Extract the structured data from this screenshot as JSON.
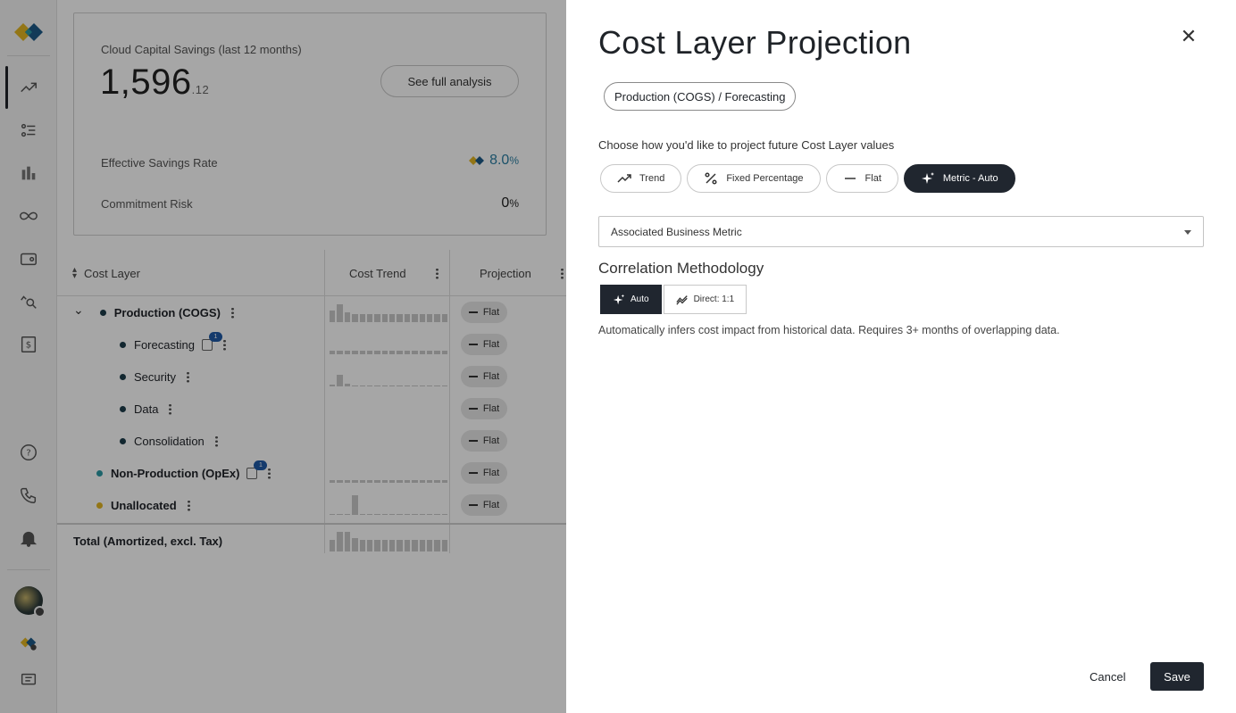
{
  "summary": {
    "title": "Cloud Capital Savings (last 12 months)",
    "amount_main": "1,596",
    "amount_decimal": ".12",
    "see_analysis": "See full analysis",
    "effective_rate_label": "Effective Savings Rate",
    "effective_rate_value": "8.0",
    "effective_rate_unit": "%",
    "risk_label": "Commitment Risk",
    "risk_value": "0",
    "risk_unit": "%"
  },
  "table": {
    "headers": {
      "cost_layer": "Cost Layer",
      "cost_trend": "Cost Trend",
      "projection": "Projection"
    },
    "rows": [
      {
        "label": "Production (COGS)",
        "bold": true,
        "projection": "Flat",
        "dot": "#1c3c4a",
        "spark": [
          0.6,
          0.9,
          0.5,
          0.4,
          0.4,
          0.4,
          0.4,
          0.4,
          0.4,
          0.4,
          0.4,
          0.4,
          0.4,
          0.4,
          0.4,
          0.4
        ]
      },
      {
        "label": "Forecasting",
        "bold": false,
        "badge": "1",
        "projection": "Flat",
        "dot": "#1c3c4a",
        "spark": [
          0.2,
          0.2,
          0.2,
          0.2,
          0.2,
          0.2,
          0.2,
          0.2,
          0.2,
          0.2,
          0.2,
          0.2,
          0.2,
          0.2,
          0.2,
          0.2
        ]
      },
      {
        "label": "Security",
        "bold": false,
        "projection": "Flat",
        "dot": "#1c3c4a",
        "spark": [
          0.1,
          0.6,
          0.15,
          0.05,
          0.05,
          0.05,
          0.05,
          0.05,
          0.05,
          0.05,
          0.05,
          0.05,
          0.05,
          0.05,
          0.05,
          0.05
        ]
      },
      {
        "label": "Data",
        "bold": false,
        "projection": "Flat",
        "dot": "#1c3c4a",
        "spark": []
      },
      {
        "label": "Consolidation",
        "bold": false,
        "projection": "Flat",
        "dot": "#1c3c4a",
        "spark": []
      },
      {
        "label": "Non-Production (OpEx)",
        "bold": true,
        "badge": "1",
        "projection": "Flat",
        "dot": "#2b9aa5",
        "spark": [
          0.15,
          0.15,
          0.15,
          0.15,
          0.15,
          0.15,
          0.15,
          0.15,
          0.15,
          0.15,
          0.15,
          0.15,
          0.15,
          0.15,
          0.15,
          0.15
        ]
      },
      {
        "label": "Unallocated",
        "bold": true,
        "projection": "Flat",
        "dot": "#e2b523",
        "spark": [
          0.05,
          0.05,
          0.05,
          1.0,
          0.05,
          0.05,
          0.05,
          0.05,
          0.05,
          0.05,
          0.05,
          0.05,
          0.05,
          0.05,
          0.05,
          0.05
        ]
      }
    ],
    "total_label": "Total (Amortized, excl. Tax)",
    "total_spark": [
      0.6,
      1.0,
      1.0,
      0.7,
      0.6,
      0.6,
      0.6,
      0.6,
      0.6,
      0.6,
      0.6,
      0.6,
      0.6,
      0.6,
      0.6,
      0.6
    ]
  },
  "drawer": {
    "title": "Cost Layer Projection",
    "breadcrumb": "Production (COGS) / Forecasting",
    "prompt": "Choose how you'd like to project future Cost Layer values",
    "methods": [
      {
        "label": "Trend",
        "icon": "trend-icon",
        "selected": false
      },
      {
        "label": "Fixed Percentage",
        "icon": "percent-icon",
        "selected": false
      },
      {
        "label": "Flat",
        "icon": "flat-line-icon",
        "selected": false
      },
      {
        "label": "Metric - Auto",
        "icon": "sparkle-icon",
        "selected": true
      }
    ],
    "metric_select_placeholder": "Associated Business Metric",
    "correlation_title": "Correlation Methodology",
    "correlation_options": [
      {
        "label": "Auto",
        "icon": "sparkle-icon",
        "selected": true
      },
      {
        "label": "Direct: 1:1",
        "icon": "direct-line-icon",
        "selected": false
      }
    ],
    "correlation_description": "Automatically infers cost impact from historical data. Requires 3+ months of overlapping data.",
    "cancel": "Cancel",
    "save": "Save"
  },
  "colors": {
    "accent_dark": "#20262f",
    "rate_blue": "#2b7fa3",
    "brand_yellow": "#e2b523",
    "brand_teal": "#2b9aa5"
  }
}
